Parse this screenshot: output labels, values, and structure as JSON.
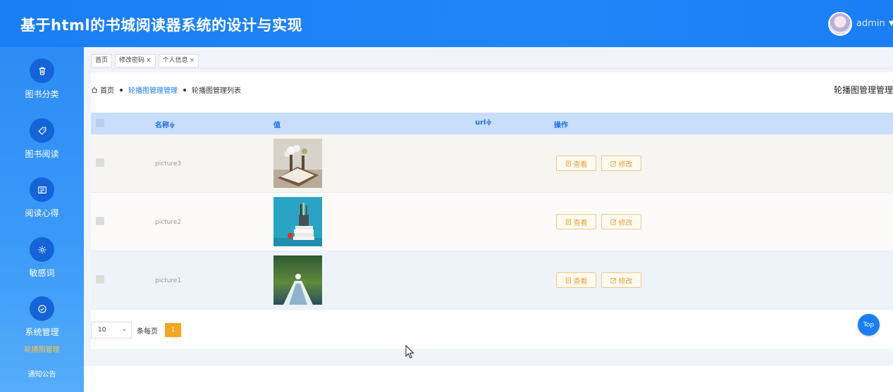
{
  "app": {
    "title": "基于html的书城阅读器系统的设计与实现"
  },
  "user": {
    "name": "admin"
  },
  "sidebar": {
    "items": [
      {
        "label": "图书分类",
        "icon": "trash-icon"
      },
      {
        "label": "图书阅读",
        "icon": "tag-icon"
      },
      {
        "label": "阅读心得",
        "icon": "news-icon"
      },
      {
        "label": "敏感词",
        "icon": "gear-icon"
      },
      {
        "label": "系统管理",
        "icon": "check-circle-icon"
      }
    ],
    "sub_items": [
      {
        "label": "轮播图管理",
        "active": true
      },
      {
        "label": "通知公告",
        "active": false
      }
    ]
  },
  "tags": [
    {
      "label": "首页",
      "closable": false
    },
    {
      "label": "修改密码",
      "closable": true
    },
    {
      "label": "个人信息",
      "closable": true
    }
  ],
  "tag_close": "×",
  "breadcrumb": {
    "home": "首页",
    "parent": "轮播图管理管理",
    "current": "轮播图管理列表"
  },
  "page_heading": "轮播图管理管理",
  "table": {
    "columns": {
      "name": "名称",
      "value": "值",
      "url": "url",
      "actions": "操作"
    },
    "sort_indicator": "≑",
    "rows": [
      {
        "name": "picture3"
      },
      {
        "name": "picture2"
      },
      {
        "name": "picture1"
      }
    ],
    "view_label": "查看",
    "edit_label": "修改"
  },
  "pagination": {
    "page_size": "10",
    "per_page_label": "条每页",
    "current_page": "1"
  },
  "top_button": "Top",
  "colors": {
    "primary": "#1a7ef5",
    "accent": "#f5a623",
    "sidebar_circle": "#1463d8",
    "active_sub": "#f7c948"
  }
}
